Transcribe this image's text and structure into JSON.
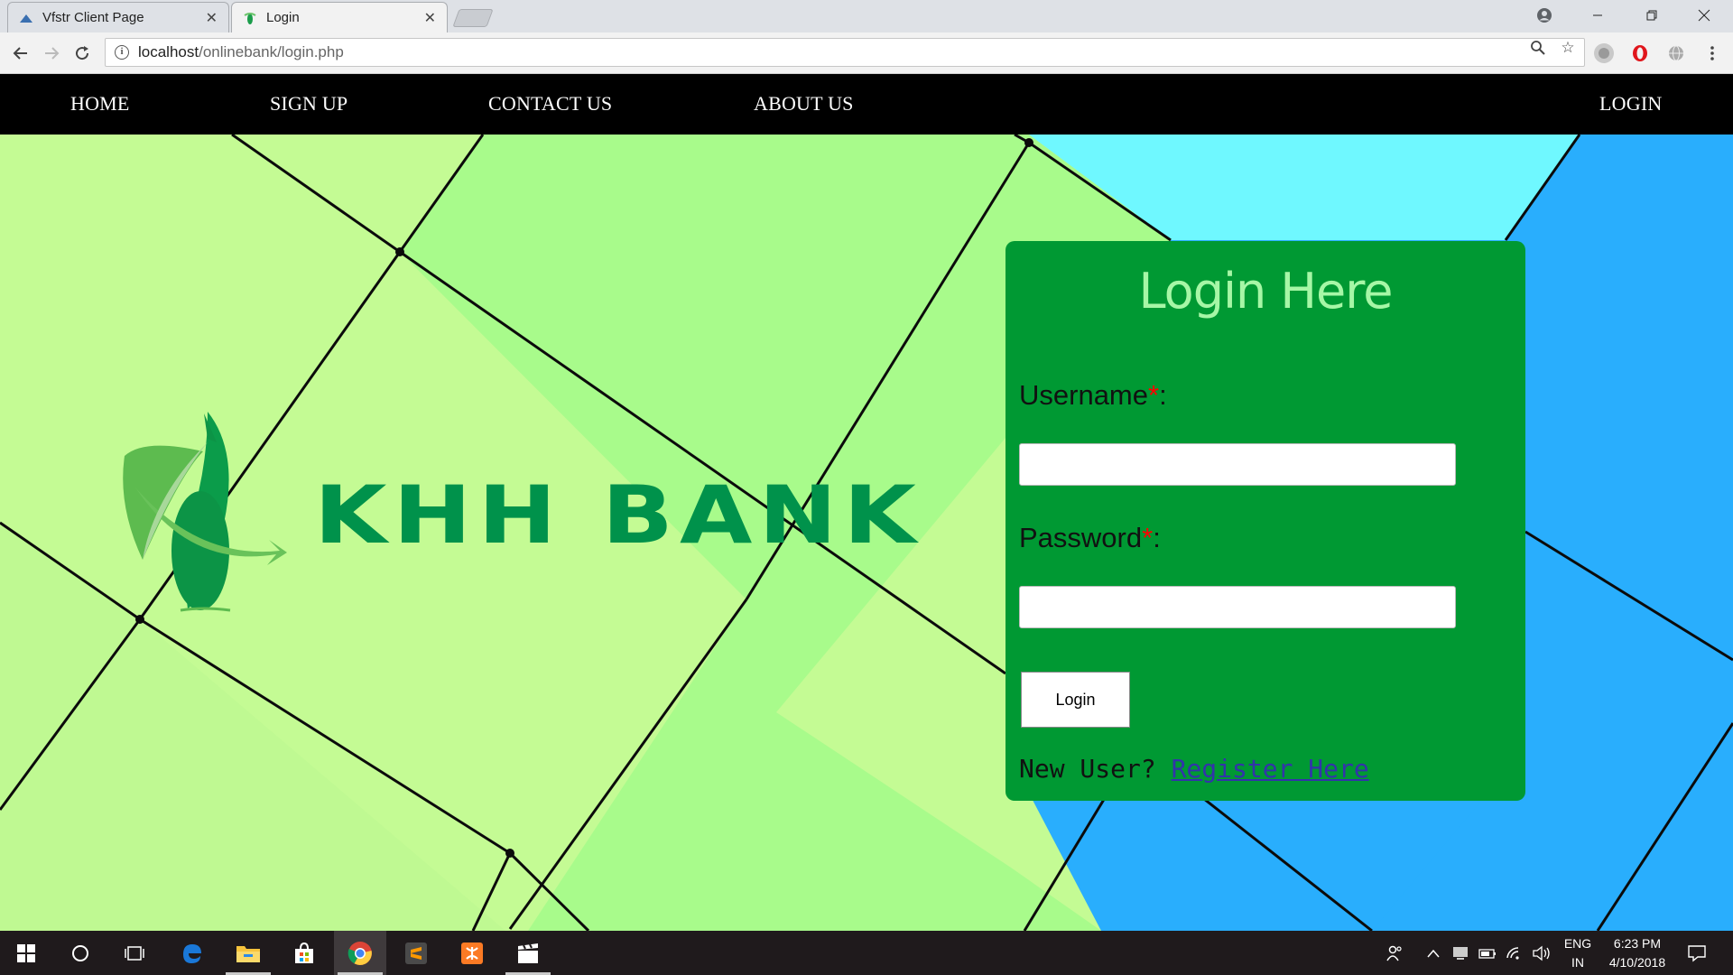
{
  "browser": {
    "tabs": [
      {
        "title": "Vfstr Client Page",
        "active": false
      },
      {
        "title": "Login",
        "active": true
      }
    ],
    "address": {
      "host": "localhost",
      "path": "/onlinebank/login.php"
    }
  },
  "site_nav": {
    "items": [
      "HOME",
      "SIGN UP",
      "CONTACT US",
      "ABOUT US"
    ],
    "login": "LOGIN"
  },
  "logo": {
    "text": "KHH BANK",
    "color": "#00924b"
  },
  "login_form": {
    "title": "Login Here",
    "username_label": "Username",
    "password_label": "Password",
    "required_mark": "*",
    "label_suffix": ":",
    "button_label": "Login",
    "new_user_text": "New User?",
    "register_link": "Register Here",
    "panel_color": "#009933",
    "title_color": "#a6f7a6"
  },
  "taskbar": {
    "language_line1": "ENG",
    "language_line2": "IN",
    "time": "6:23 PM",
    "date": "4/10/2018"
  },
  "colors": {
    "bg_light_green": "#c4fb94",
    "bg_green": "#a8fb8b",
    "bg_cyan": "#6ff8ff",
    "bg_blue": "#29aefd",
    "nav_bg": "#000000"
  }
}
